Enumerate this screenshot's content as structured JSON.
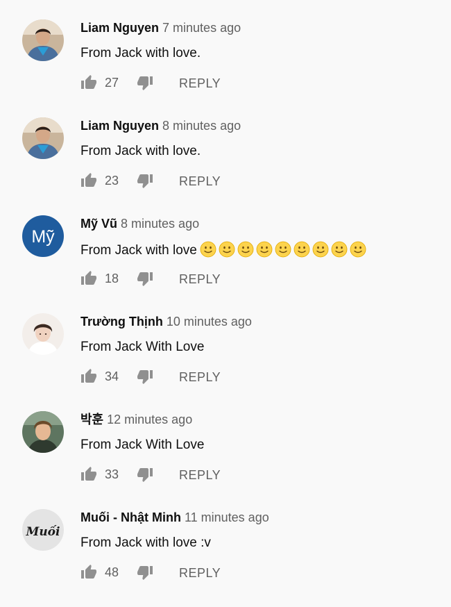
{
  "comments": [
    {
      "author": "Liam Nguyen",
      "time": "7 minutes ago",
      "text": "From Jack with love.",
      "likes": "27",
      "reply_label": "REPLY",
      "emoji_count": 0
    },
    {
      "author": "Liam Nguyen",
      "time": "8 minutes ago",
      "text": "From Jack with love.",
      "likes": "23",
      "reply_label": "REPLY",
      "emoji_count": 0
    },
    {
      "author": "Mỹ Vũ",
      "time": "8 minutes ago",
      "text": "From Jack with love",
      "likes": "18",
      "reply_label": "REPLY",
      "emoji_count": 9,
      "avatar_text": "Mỹ",
      "avatar_color": "#1f5c9e"
    },
    {
      "author": "Trường Thịnh",
      "time": "10 minutes ago",
      "text": "From Jack With Love",
      "likes": "34",
      "reply_label": "REPLY",
      "emoji_count": 0
    },
    {
      "author": "박훈",
      "time": "12 minutes ago",
      "text": "From Jack With Love",
      "likes": "33",
      "reply_label": "REPLY",
      "emoji_count": 0
    },
    {
      "author": "Muối - Nhật Minh",
      "time": "11 minutes ago",
      "text": "From Jack with love :v",
      "likes": "48",
      "reply_label": "REPLY",
      "emoji_count": 0,
      "avatar_text": "Muối"
    }
  ],
  "icons": {
    "like": "thumbs-up-icon",
    "dislike": "thumbs-down-icon",
    "emoji": "slightly-smiling-face-emoji"
  },
  "colors": {
    "background": "#f9f9f9",
    "author": "#0f0f0f",
    "secondary_text": "#606060",
    "icon": "#909090"
  }
}
